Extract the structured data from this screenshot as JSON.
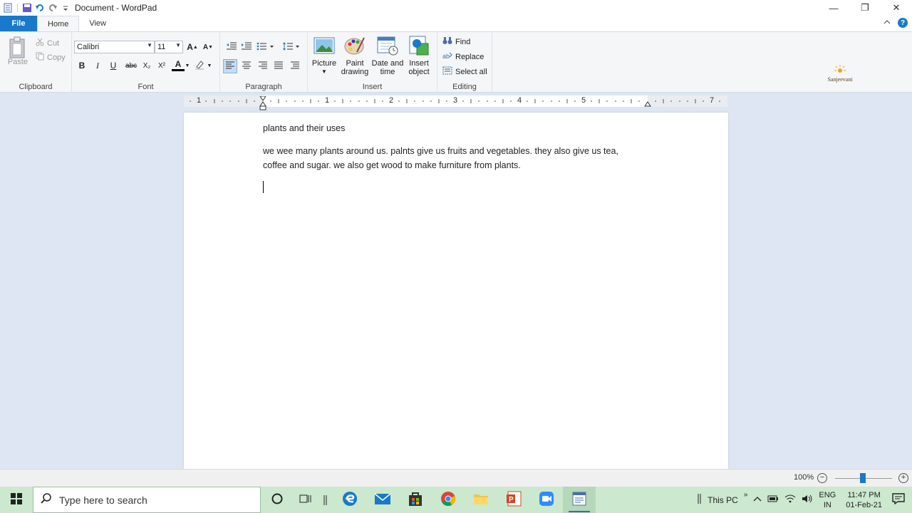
{
  "window": {
    "title": "Document - WordPad",
    "controls": {
      "minimize": "—",
      "restore": "❐",
      "close": "✕"
    }
  },
  "tabs": [
    "File",
    "Home",
    "View"
  ],
  "ribbon": {
    "clipboard": {
      "label": "Clipboard",
      "paste": "Paste",
      "cut": "Cut",
      "copy": "Copy"
    },
    "font": {
      "label": "Font",
      "family": "Calibri",
      "size": "11",
      "bold": "B",
      "italic": "I",
      "underline": "U",
      "strike": "abc",
      "subscript": "X₂",
      "superscript": "X²",
      "font_color": "A"
    },
    "paragraph": {
      "label": "Paragraph"
    },
    "insert": {
      "label": "Insert",
      "picture": "Picture",
      "paint1": "Paint",
      "paint2": "drawing",
      "datetime1": "Date and",
      "datetime2": "time",
      "object1": "Insert",
      "object2": "object"
    },
    "editing": {
      "label": "Editing",
      "find": "Find",
      "replace": "Replace",
      "select_all": "Select all"
    }
  },
  "logo": {
    "text": "Sanjeevani"
  },
  "ruler": {
    "numbers": [
      "1",
      "1",
      "2",
      "3",
      "4",
      "5",
      "7"
    ]
  },
  "document": {
    "line1": "plants and their uses",
    "line2": "we wee many plants around us. palnts give us fruits and vegetables. they also give us tea,",
    "line3": "coffee and sugar. we also get wood to make furniture from plants."
  },
  "status": {
    "zoom": "100%"
  },
  "taskbar": {
    "search_placeholder": "Type here to search",
    "this_pc": "This PC",
    "lang1": "ENG",
    "lang2": "IN",
    "time": "11:47 PM",
    "date": "01-Feb-21"
  },
  "colors": {
    "accent": "#1979ca",
    "taskbar": "#cce8cf",
    "ribbon": "#f5f6f7",
    "workspace": "#dde6f2"
  }
}
